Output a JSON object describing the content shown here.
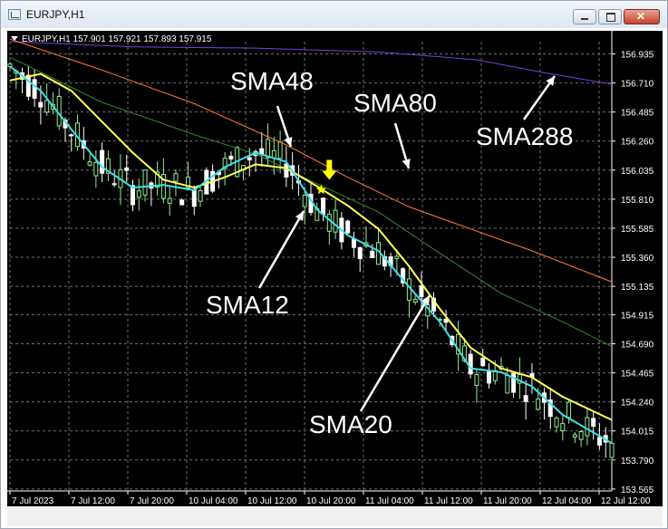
{
  "window": {
    "title": "EURJPY,H1"
  },
  "chart": {
    "header_text": "EURJPY,H1  157.901 157.921 157.893 157.915",
    "background": "#000000",
    "grid_color": "#6e6e6e",
    "up_candle_color": "#90ee90",
    "down_candle_color": "#ffffff",
    "ma_colors": {
      "SMA12": "#40e0e8",
      "SMA20": "#ffff55",
      "SMA48": "#2e8b2e",
      "SMA80": "#ff7a32",
      "SMA288": "#7b3fe0"
    },
    "signal_arrow_color": "#ffff00"
  },
  "chart_data": {
    "type": "line",
    "title": "EURJPY,H1",
    "y_ticks": [
      156.935,
      156.71,
      156.485,
      156.26,
      156.035,
      155.81,
      155.585,
      155.36,
      155.135,
      154.915,
      154.69,
      154.465,
      154.24,
      154.015,
      153.79,
      153.565
    ],
    "ylim": [
      153.55,
      157.03
    ],
    "x_ticks": [
      "7 Jul 2023",
      "7 Jul 12:00",
      "7 Jul 20:00",
      "10 Jul 04:00",
      "10 Jul 12:00",
      "10 Jul 20:00",
      "11 Jul 04:00",
      "11 Jul 12:00",
      "11 Jul 20:00",
      "12 Jul 04:00",
      "12 Jul 12:00"
    ],
    "series": [
      {
        "name": "SMA288",
        "x": [
          0,
          20,
          40,
          60,
          76,
          87,
          98
        ],
        "values": [
          157.03,
          156.99,
          156.98,
          156.95,
          156.89,
          156.79,
          156.7
        ]
      },
      {
        "name": "SMA80",
        "x": [
          0,
          15,
          30,
          45,
          55,
          65,
          75,
          85,
          98
        ],
        "values": [
          157.05,
          156.81,
          156.55,
          156.23,
          155.98,
          155.75,
          155.58,
          155.41,
          155.17
        ]
      },
      {
        "name": "SMA48",
        "x": [
          0,
          15,
          30,
          40,
          50,
          60,
          70,
          80,
          90,
          98
        ],
        "values": [
          156.91,
          156.56,
          156.31,
          156.16,
          155.93,
          155.71,
          155.39,
          155.08,
          154.86,
          154.67
        ]
      },
      {
        "name": "SMA20",
        "x": [
          0,
          5,
          10,
          15,
          20,
          25,
          30,
          35,
          40,
          45,
          50,
          55,
          60,
          65,
          70,
          75,
          80,
          85,
          90,
          98
        ],
        "values": [
          156.73,
          156.78,
          156.65,
          156.41,
          156.17,
          155.96,
          155.9,
          155.98,
          156.08,
          156.05,
          155.91,
          155.76,
          155.58,
          155.29,
          154.96,
          154.66,
          154.5,
          154.43,
          154.28,
          154.1
        ]
      },
      {
        "name": "SMA12",
        "x": [
          0,
          5,
          10,
          15,
          20,
          25,
          30,
          35,
          40,
          45,
          50,
          55,
          60,
          65,
          70,
          75,
          80,
          85,
          90,
          98
        ],
        "values": [
          156.84,
          156.65,
          156.35,
          156.06,
          155.9,
          155.92,
          155.88,
          156.06,
          156.17,
          156.1,
          155.73,
          155.53,
          155.41,
          155.13,
          154.86,
          154.5,
          154.47,
          154.36,
          154.14,
          153.92
        ]
      }
    ],
    "annotations": [
      "SMA48",
      "SMA80",
      "SMA288",
      "SMA12",
      "SMA20"
    ],
    "grid": true
  }
}
